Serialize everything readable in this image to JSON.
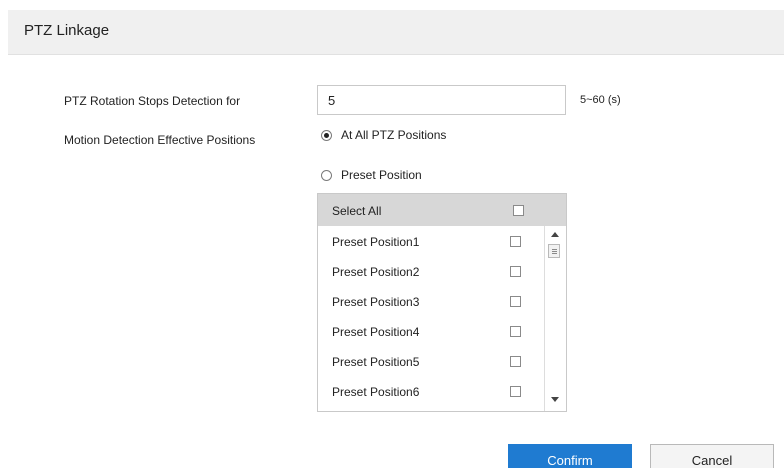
{
  "header": {
    "title": "PTZ Linkage"
  },
  "form": {
    "rotation_stop_label": "PTZ Rotation Stops Detection for",
    "rotation_stop_value": "5",
    "rotation_stop_range": "5~60  (s)",
    "effective_positions_label": "Motion Detection Effective Positions",
    "option_all_label": "At All PTZ Positions",
    "option_preset_label": "Preset Position",
    "selected_option": "At All PTZ Positions"
  },
  "preset_list": {
    "select_all_label": "Select All",
    "select_all_checked": false,
    "items": [
      {
        "label": "Preset Position1",
        "checked": false
      },
      {
        "label": "Preset Position2",
        "checked": false
      },
      {
        "label": "Preset Position3",
        "checked": false
      },
      {
        "label": "Preset Position4",
        "checked": false
      },
      {
        "label": "Preset Position5",
        "checked": false
      },
      {
        "label": "Preset Position6",
        "checked": false
      }
    ]
  },
  "buttons": {
    "confirm_label": "Confirm",
    "cancel_label": "Cancel"
  },
  "colors": {
    "accent": "#1f7bd1",
    "header_bg": "#f0f0f0",
    "list_header_bg": "#d7d7d7"
  }
}
